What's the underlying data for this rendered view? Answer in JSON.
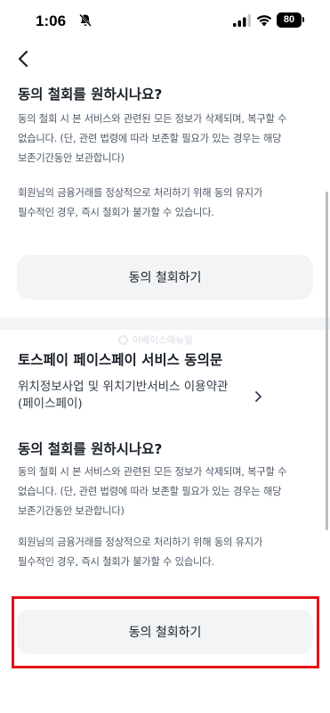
{
  "status_bar": {
    "time": "1:06",
    "battery": "80",
    "icons": [
      "bell-off-icon",
      "cellular-signal-icon",
      "wifi-icon",
      "battery-icon"
    ]
  },
  "nav": {
    "back_icon": "chevron-left-icon"
  },
  "section1": {
    "title": "동의 철회를 원하시나요?",
    "para1_lines": [
      "동의 철회 시 본 서비스와 관련된 모든 정보가 삭제되며, 복구할 수",
      "없습니다. (단, 관련 법령에 따라 보존할 필요가 있는 경우는 해당",
      "보존기간동안 보관합니다)"
    ],
    "para2_lines": [
      "회원님의 금융거래를 정상적으로 처리하기 위해 동의 유지가",
      "필수적인 경우, 즉시 철회가 불가할 수 있습니다."
    ],
    "button": "동의 철회하기"
  },
  "watermark": "어베이스매뉴얼",
  "section2": {
    "service_title": "토스페이 페이스페이 서비스 동의문",
    "link_lines": [
      "위치정보사업 및 위치기반서비스 이용약관",
      "(페이스페이)"
    ],
    "title": "동의 철회를 원하시나요?",
    "para1_lines": [
      "동의 철회 시 본 서비스와 관련된 모든 정보가 삭제되며, 복구할 수",
      "없습니다. (단, 관련 법령에 따라 보존할 필요가 있는 경우는 해당",
      "보존기간동안 보관합니다)"
    ],
    "para2_lines": [
      "회원님의 금융거래를 정상적으로 처리하기 위해 동의 유지가",
      "필수적인 경우, 즉시 철회가 불가할 수 있습니다."
    ],
    "button": "동의 철회하기"
  },
  "colors": {
    "highlight": "#e4111a",
    "button_bg": "#f2f4f6",
    "divider": "#f2f4f6",
    "text_primary": "#191f28",
    "text_secondary": "#4e5968"
  }
}
